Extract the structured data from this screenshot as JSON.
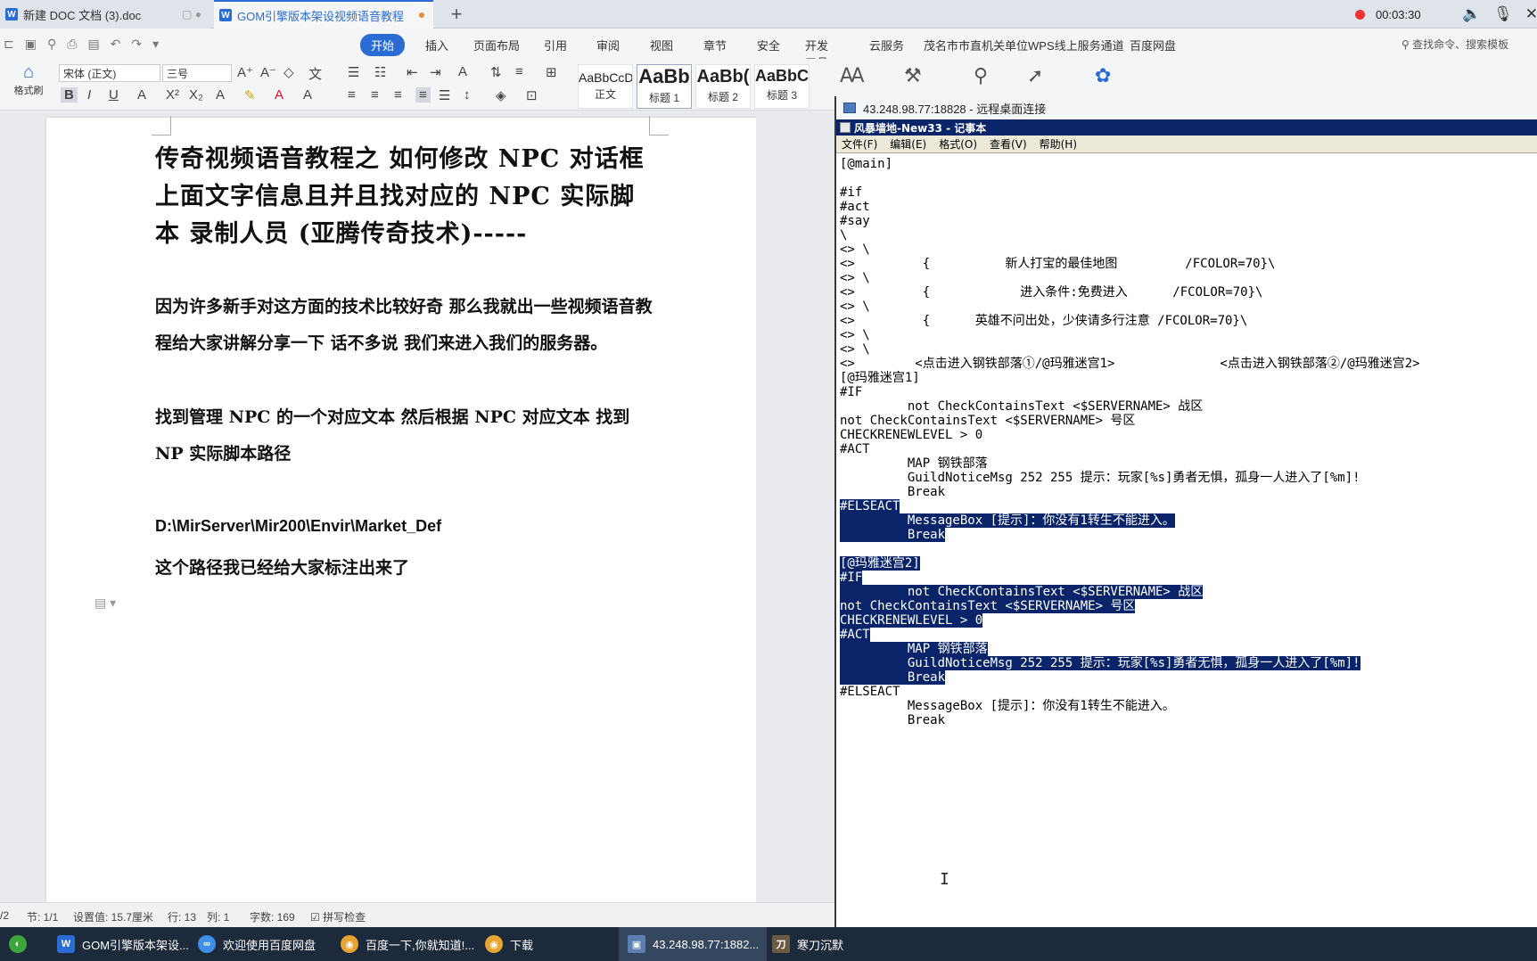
{
  "tabs": {
    "doc1": "新建 DOC 文档 (3).doc",
    "doc2": "GOM引擎版本架设视频语音教程",
    "add": "+"
  },
  "recorder": {
    "time": "00:03:30"
  },
  "menu": {
    "start": "开始",
    "insert": "插入",
    "layout": "页面布局",
    "ref": "引用",
    "review": "审阅",
    "view": "视图",
    "chapter": "章节",
    "security": "安全",
    "dev": "开发工具",
    "cloud": "云服务",
    "wps_service": "茂名市市直机关单位WPS线上服务通道",
    "netdisk": "百度网盘",
    "search": "查找命令、搜索模板"
  },
  "ribbon": {
    "format_brush": "格式刷",
    "font_name": "宋体 (正文)",
    "font_size": "三号",
    "styles": [
      {
        "preview": "AaBbCcDd",
        "name": "正文"
      },
      {
        "preview": "AaBb",
        "name": "标题 1"
      },
      {
        "preview": "AaBb(",
        "name": "标题 2"
      },
      {
        "preview": "AaBbC",
        "name": "标题 3"
      }
    ]
  },
  "document": {
    "title": "传奇视频语音教程之  如何修改 NPC 对话框上面文字信息且并且找对应的 NPC 实际脚本  录制人员  (亚腾传奇技术)-----",
    "para1": "因为许多新手对这方面的技术比较好奇  那么我就出一些视频语音教程给大家讲解分享一下  话不多说  我们来进入我们的服务器。",
    "para2": "找到管理 NPC 的一个对应文本  然后根据 NPC 对应文本  找到 NP 实际脚本路径",
    "path": "D:\\MirServer\\Mir200\\Envir\\Market_Def",
    "path_note": "这个路径我已经给大家标注出来了"
  },
  "status": {
    "page": "/2",
    "section": "节: 1/1",
    "setting": "设置值: 15.7厘米",
    "row": "行: 13",
    "col": "列: 1",
    "words": "字数: 169",
    "spell": "拼写检查"
  },
  "rdp": {
    "title": "43.248.98.77:18828 - 远程桌面连接",
    "notepad_title": "风暴墙地-New33 - 记事本",
    "menu": [
      "文件(F)",
      "编辑(E)",
      "格式(O)",
      "查看(V)",
      "帮助(H)"
    ],
    "lines": [
      {
        "t": "[@main]",
        "s": 0
      },
      {
        "t": "",
        "s": 0
      },
      {
        "t": "#if",
        "s": 0
      },
      {
        "t": "#act",
        "s": 0
      },
      {
        "t": "#say",
        "s": 0
      },
      {
        "t": "\\",
        "s": 0
      },
      {
        "t": "<> \\",
        "s": 0
      },
      {
        "t": "<>         {          新人打宝的最佳地图         /FCOLOR=70}\\",
        "s": 0
      },
      {
        "t": "<> \\",
        "s": 0
      },
      {
        "t": "<>         {            进入条件:免费进入      /FCOLOR=70}\\",
        "s": 0
      },
      {
        "t": "<> \\",
        "s": 0
      },
      {
        "t": "<>         {      英雄不问出处，少侠请多行注意 /FCOLOR=70}\\",
        "s": 0
      },
      {
        "t": "<> \\",
        "s": 0
      },
      {
        "t": "<> \\",
        "s": 0
      },
      {
        "t": "<>        <点击进入钢铁部落①/@玛雅迷宫1>              <点击进入钢铁部落②/@玛雅迷宫2>",
        "s": 0
      },
      {
        "t": "[@玛雅迷宫1]",
        "s": 0
      },
      {
        "t": "#IF",
        "s": 0
      },
      {
        "t": "         not CheckContainsText <$SERVERNAME> 战区",
        "s": 0
      },
      {
        "t": "not CheckContainsText <$SERVERNAME> 号区",
        "s": 0
      },
      {
        "t": "CHECKRENEWLEVEL > 0",
        "s": 0
      },
      {
        "t": "#ACT",
        "s": 0
      },
      {
        "t": "         MAP 钢铁部落",
        "s": 0
      },
      {
        "t": "         GuildNoticeMsg 252 255 提示：玩家[%s]勇者无惧，孤身一人进入了[%m]!",
        "s": 0
      },
      {
        "t": "         Break",
        "s": 0
      },
      {
        "t": "#ELSEACT",
        "s": 1
      },
      {
        "t": "         MessageBox [提示]：你没有1转生不能进入。",
        "s": 1
      },
      {
        "t": "         Break",
        "s": 1
      },
      {
        "t": "",
        "s": 0
      },
      {
        "t": "[@玛雅迷宫2]",
        "s": 1
      },
      {
        "t": "#IF",
        "s": 1
      },
      {
        "t": "         not CheckContainsText <$SERVERNAME> 战区",
        "s": 1
      },
      {
        "t": "not CheckContainsText <$SERVERNAME> 号区",
        "s": 1
      },
      {
        "t": "CHECKRENEWLEVEL > 0",
        "s": 1
      },
      {
        "t": "#ACT",
        "s": 1
      },
      {
        "t": "         MAP 钢铁部落",
        "s": 1
      },
      {
        "t": "         GuildNoticeMsg 252 255 提示：玩家[%s]勇者无惧，孤身一人进入了[%m]!",
        "s": 1
      },
      {
        "t": "         Break",
        "s": 1
      },
      {
        "t": "#ELSEACT",
        "s": 0
      },
      {
        "t": "         MessageBox [提示]：你没有1转生不能进入。",
        "s": 0
      },
      {
        "t": "         Break",
        "s": 0
      }
    ]
  },
  "taskbar": {
    "items": [
      "GOM引擎版本架设...",
      "欢迎使用百度网盘",
      "百度一下,你就知道!...",
      "下载",
      "43.248.98.77:1882...",
      "寒刀沉默"
    ]
  },
  "colors": {
    "accent": "#2b6cd4",
    "selection": "#0a246a",
    "taskbar": "#1c2a3b"
  }
}
